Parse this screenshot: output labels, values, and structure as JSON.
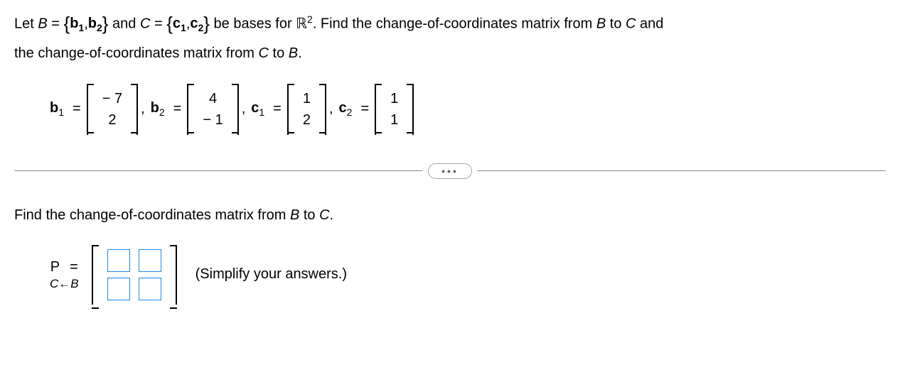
{
  "problem": {
    "line1_part1": "Let ",
    "B_var": "B",
    "equals": " = ",
    "b1_set": "b",
    "b2_set": "b",
    "and_text": " and ",
    "C_var": "C",
    "c1_set": "c",
    "c2_set": "c",
    "line1_part2": " be bases for ",
    "R_sym": "ℝ",
    "R_exp": "2",
    "line1_part3": ". Find the change-of-coordinates matrix from ",
    "to_text": " to ",
    "and2": " and",
    "line2": "the change-of-coordinates matrix from ",
    "period": "."
  },
  "vectors": {
    "b1": {
      "label": "b",
      "sub": "1",
      "r1": "− 7",
      "r2": "2"
    },
    "b2": {
      "label": "b",
      "sub": "2",
      "r1": "4",
      "r2": "− 1"
    },
    "c1": {
      "label": "c",
      "sub": "1",
      "r1": "1",
      "r2": "2"
    },
    "c2": {
      "label": "c",
      "sub": "2",
      "r1": "1",
      "r2": "1"
    }
  },
  "dots": "•••",
  "answer": {
    "prompt_part1": "Find the change-of-coordinates matrix from ",
    "B_var": "B",
    "to_text": " to ",
    "C_var": "C",
    "period": ".",
    "P_label": "P",
    "eq": "=",
    "C_sub": "C",
    "arrow": "←",
    "B_sub": "B",
    "simplify": "(Simplify your answers.)"
  }
}
